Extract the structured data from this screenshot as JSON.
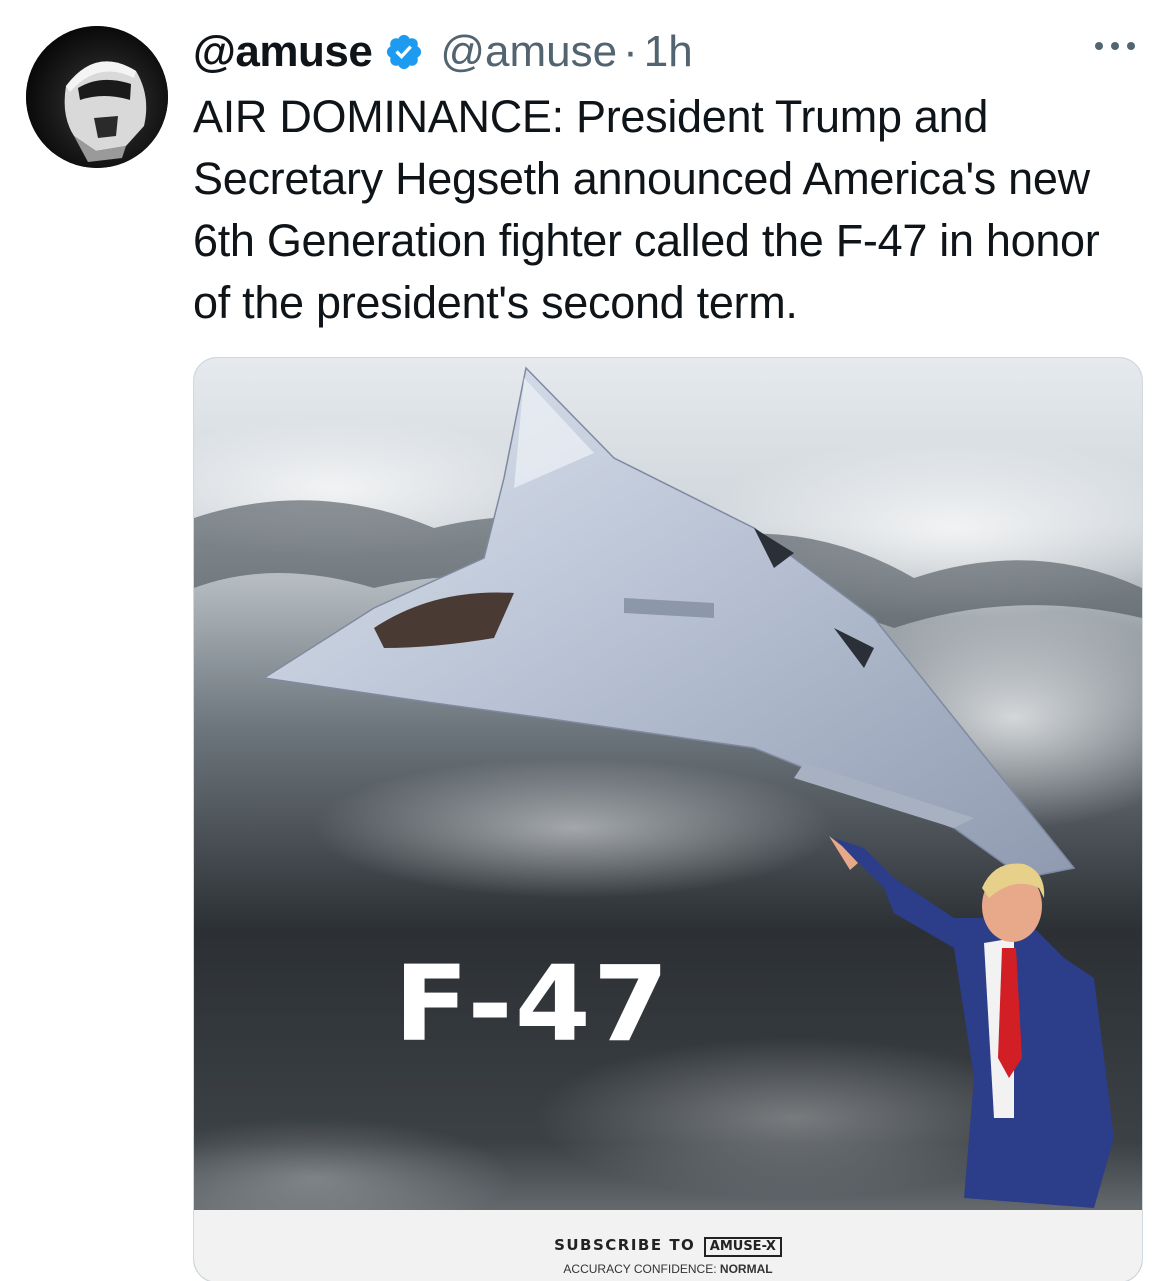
{
  "author": {
    "display_name": "@amuse",
    "handle": "@amuse",
    "separator": "·",
    "time": "1h",
    "verified": true,
    "verified_color": "#1d9bf0"
  },
  "menu": {
    "icon": "more-horizontal-icon"
  },
  "tweet": {
    "text": "AIR DOMINANCE: President Trump and Secretary Hegseth announced America's new 6th Generation fighter called the F-47 in honor of the president's second term."
  },
  "media": {
    "label": "F-47",
    "subscribe_text": "SUBSCRIBE TO",
    "brand": "AMUSE-X",
    "accuracy_label": "ACCURACY CONFIDENCE:",
    "accuracy_value": "NORMAL"
  }
}
